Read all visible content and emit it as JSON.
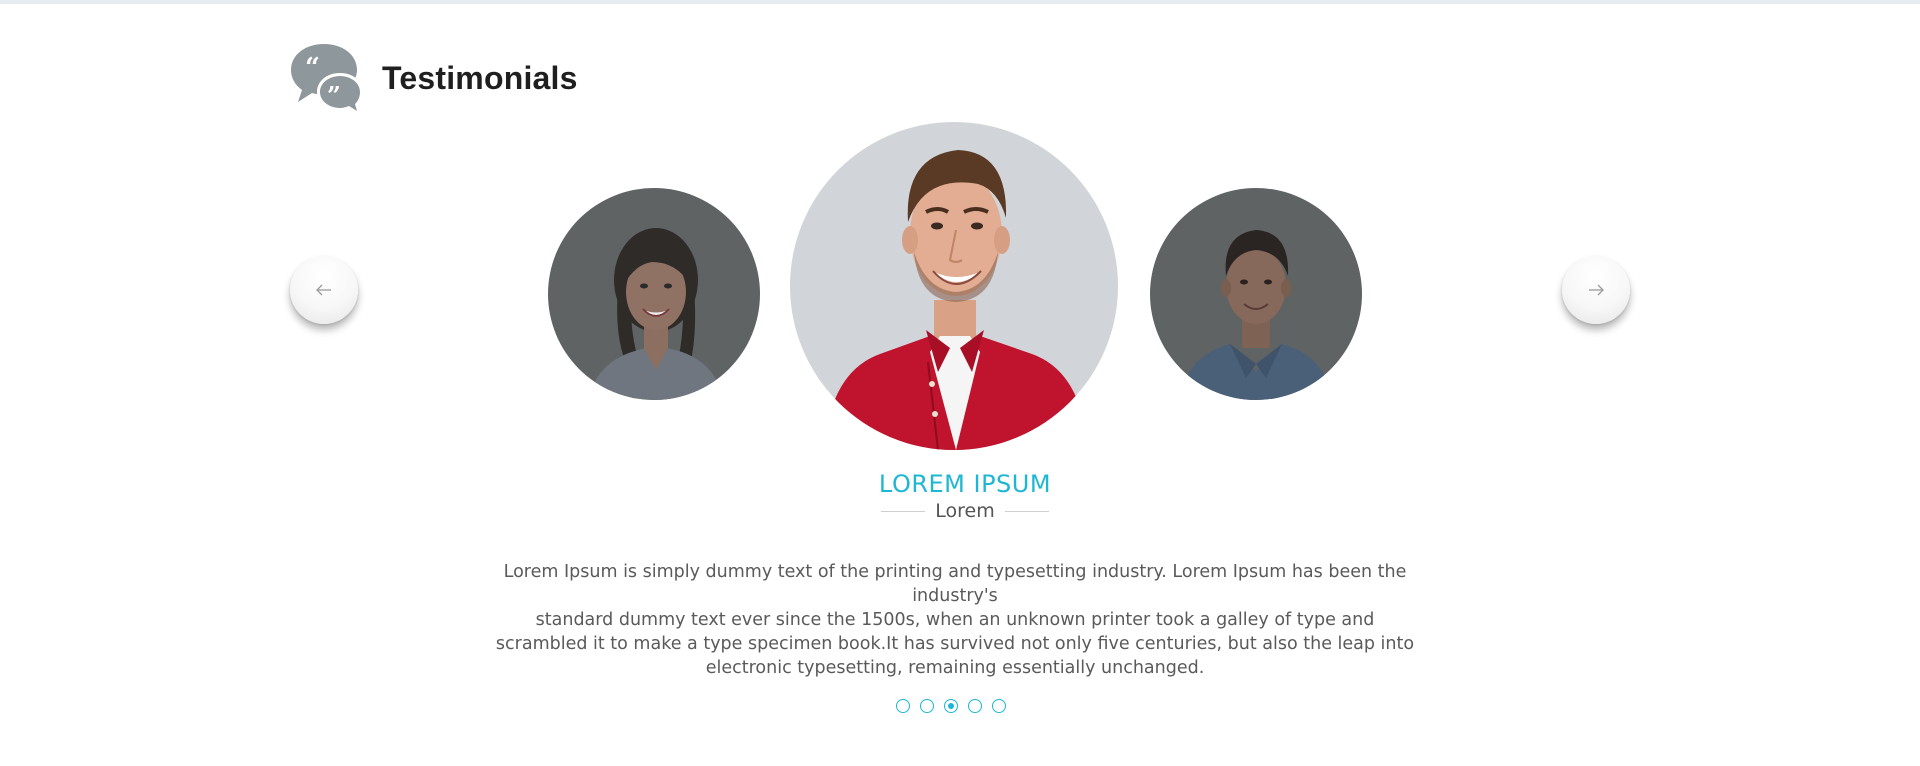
{
  "section": {
    "title": "Testimonials",
    "icon": "quote-bubbles-icon",
    "icon_color": "#8e979c"
  },
  "carousel": {
    "prev_icon": "arrow-left-icon",
    "next_icon": "arrow-right-icon",
    "avatars": [
      {
        "position": "left",
        "description_icon": "woman-avatar-photo",
        "dimmed": true
      },
      {
        "position": "center",
        "description_icon": "man-red-shirt-avatar-photo",
        "dimmed": false
      },
      {
        "position": "right",
        "description_icon": "man-blue-shirt-avatar-photo",
        "dimmed": true
      }
    ],
    "active_index": 2,
    "dot_count": 5
  },
  "testimonial": {
    "name": "LOREM IPSUM",
    "role": "Lorem",
    "quote_lines": [
      "Lorem Ipsum is simply dummy text of the printing and typesetting industry. Lorem Ipsum has been the industry's",
      "standard dummy text ever since the 1500s, when an unknown printer took a galley of type and",
      "scrambled it to make a type specimen book.It has survived not only five centuries, but also the leap into",
      "electronic typesetting, remaining essentially unchanged."
    ]
  },
  "colors": {
    "accent": "#1eb7d3",
    "title": "#1f1f1f",
    "body_text": "#5a5a5a",
    "dim_overlay": "#5f6363"
  }
}
